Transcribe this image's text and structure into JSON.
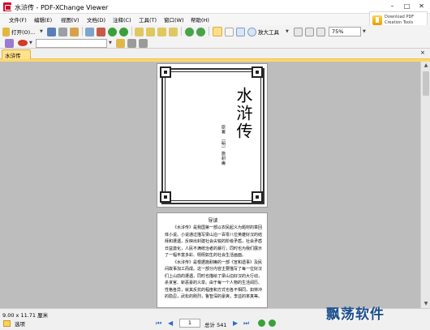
{
  "window": {
    "title": "水浒传 - PDF-XChange Viewer",
    "minimize_glyph": "–",
    "maximize_glyph": "□",
    "close_glyph": "✕"
  },
  "menu": {
    "items": [
      "文件(F)",
      "编辑(E)",
      "视图(V)",
      "文档(D)",
      "注释(C)",
      "工具(T)",
      "窗口(W)",
      "帮助(H)"
    ]
  },
  "promo": {
    "line1": "Download PDF",
    "line2": "Creation Tools"
  },
  "toolbar": {
    "open_label": "打开(O)...",
    "zoom_tool_label": "放大工具",
    "zoom_value": "75%",
    "colors": {
      "orange": "#e8a03a",
      "blue": "#2f6fc9",
      "green": "#3ba03b",
      "red": "#d23a2a",
      "gray": "#8a8a8a"
    }
  },
  "tabs": {
    "active_label": "水浒传",
    "close_glyph": "×"
  },
  "document": {
    "cover_title": "水浒传",
    "cover_author": "原著 〔明〕施耐庵",
    "guide_heading": "导读",
    "guide_paragraphs": [
      "《水浒传》是我国第一部以农民起义为题材的章回体小说。小说通过描写梁山泊一百零八位英雄好汉的结拜和遭遇，反映出封建社会尖锐的阶级矛盾，社会矛盾日益激化，人民不满统治者的暴行，同时也为我们展示了一幅丰富多彩、栩栩如生的社会生活画面。",
      "《水浒传》是根据施耐庵的一部《宣和遗事》及民间故事加工而成。这一部分内容主要描写了每一位好汉们上山前的遭遇，同时也描绘了梁山泊好汉的大行动，杀贪官、斩恶豪的义举。由于每一个人物的生活阅历、性格各异，就其反抗的程度和方式也各不相同，如林冲的隐忍，武松的刚烈，鲁智深的豪爽，李逵的率真等。"
    ]
  },
  "status": {
    "dimensions": "9.00 x 11.71 厘米",
    "options_label": "选项",
    "current_page": "1",
    "total_pages": "总计 541",
    "nav_first": "⏮",
    "nav_prev": "◀",
    "nav_next": "▶",
    "nav_last": "⏭",
    "nav_color": "#2a6dc4"
  },
  "watermark": {
    "text": "飘荡软件"
  }
}
